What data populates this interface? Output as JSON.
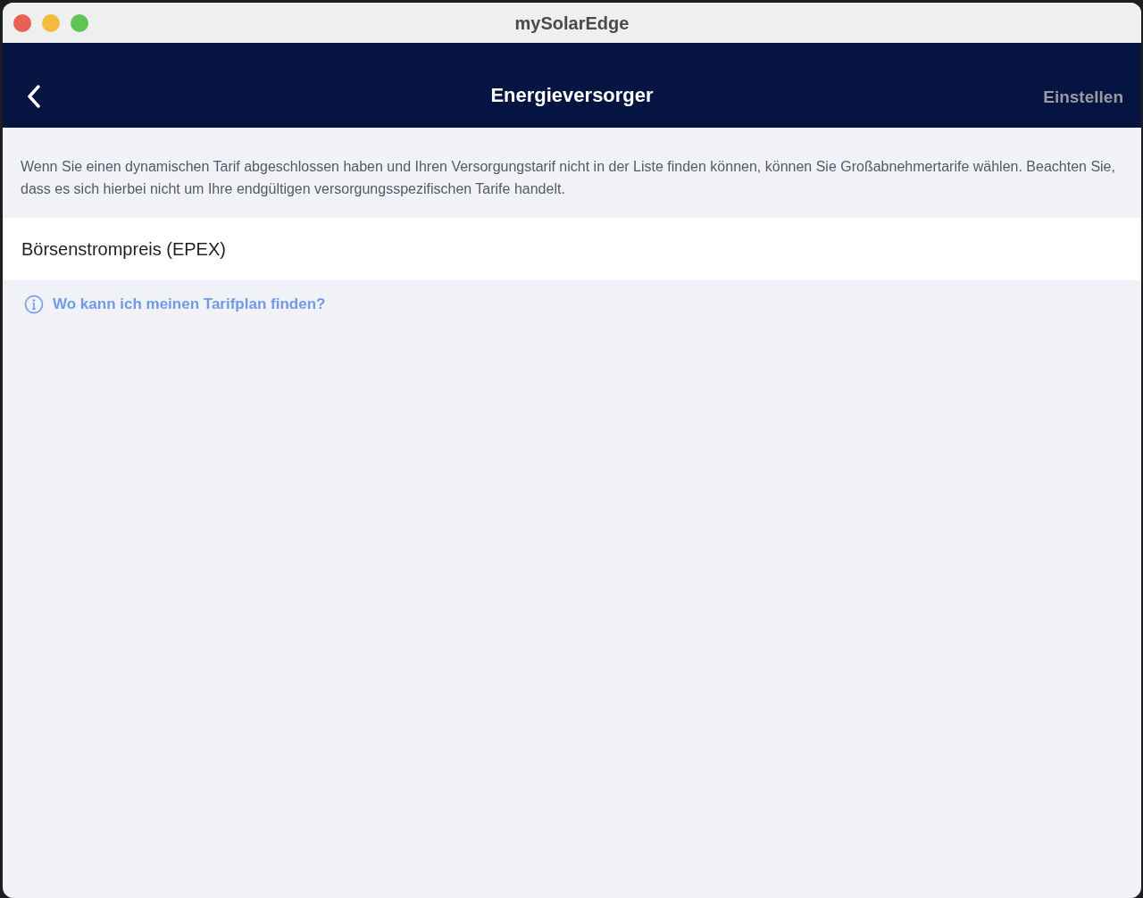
{
  "window": {
    "title": "mySolarEdge"
  },
  "header": {
    "title": "Energieversorger",
    "action": {
      "label": "Einstellen",
      "disabled": true
    }
  },
  "description": "Wenn Sie einen dynamischen Tarif abgeschlossen haben und Ihren Versorgungstarif nicht in der Liste finden können, können Sie Großabnehmertarife wählen. Beachten Sie, dass es sich hierbei nicht um Ihre endgültigen versorgungsspezifischen Tarife handelt.",
  "providers": [
    {
      "label": "Börsenstrompreis (EPEX)"
    }
  ],
  "help_link": "Wo kann ich meinen Tarifplan finden?"
}
